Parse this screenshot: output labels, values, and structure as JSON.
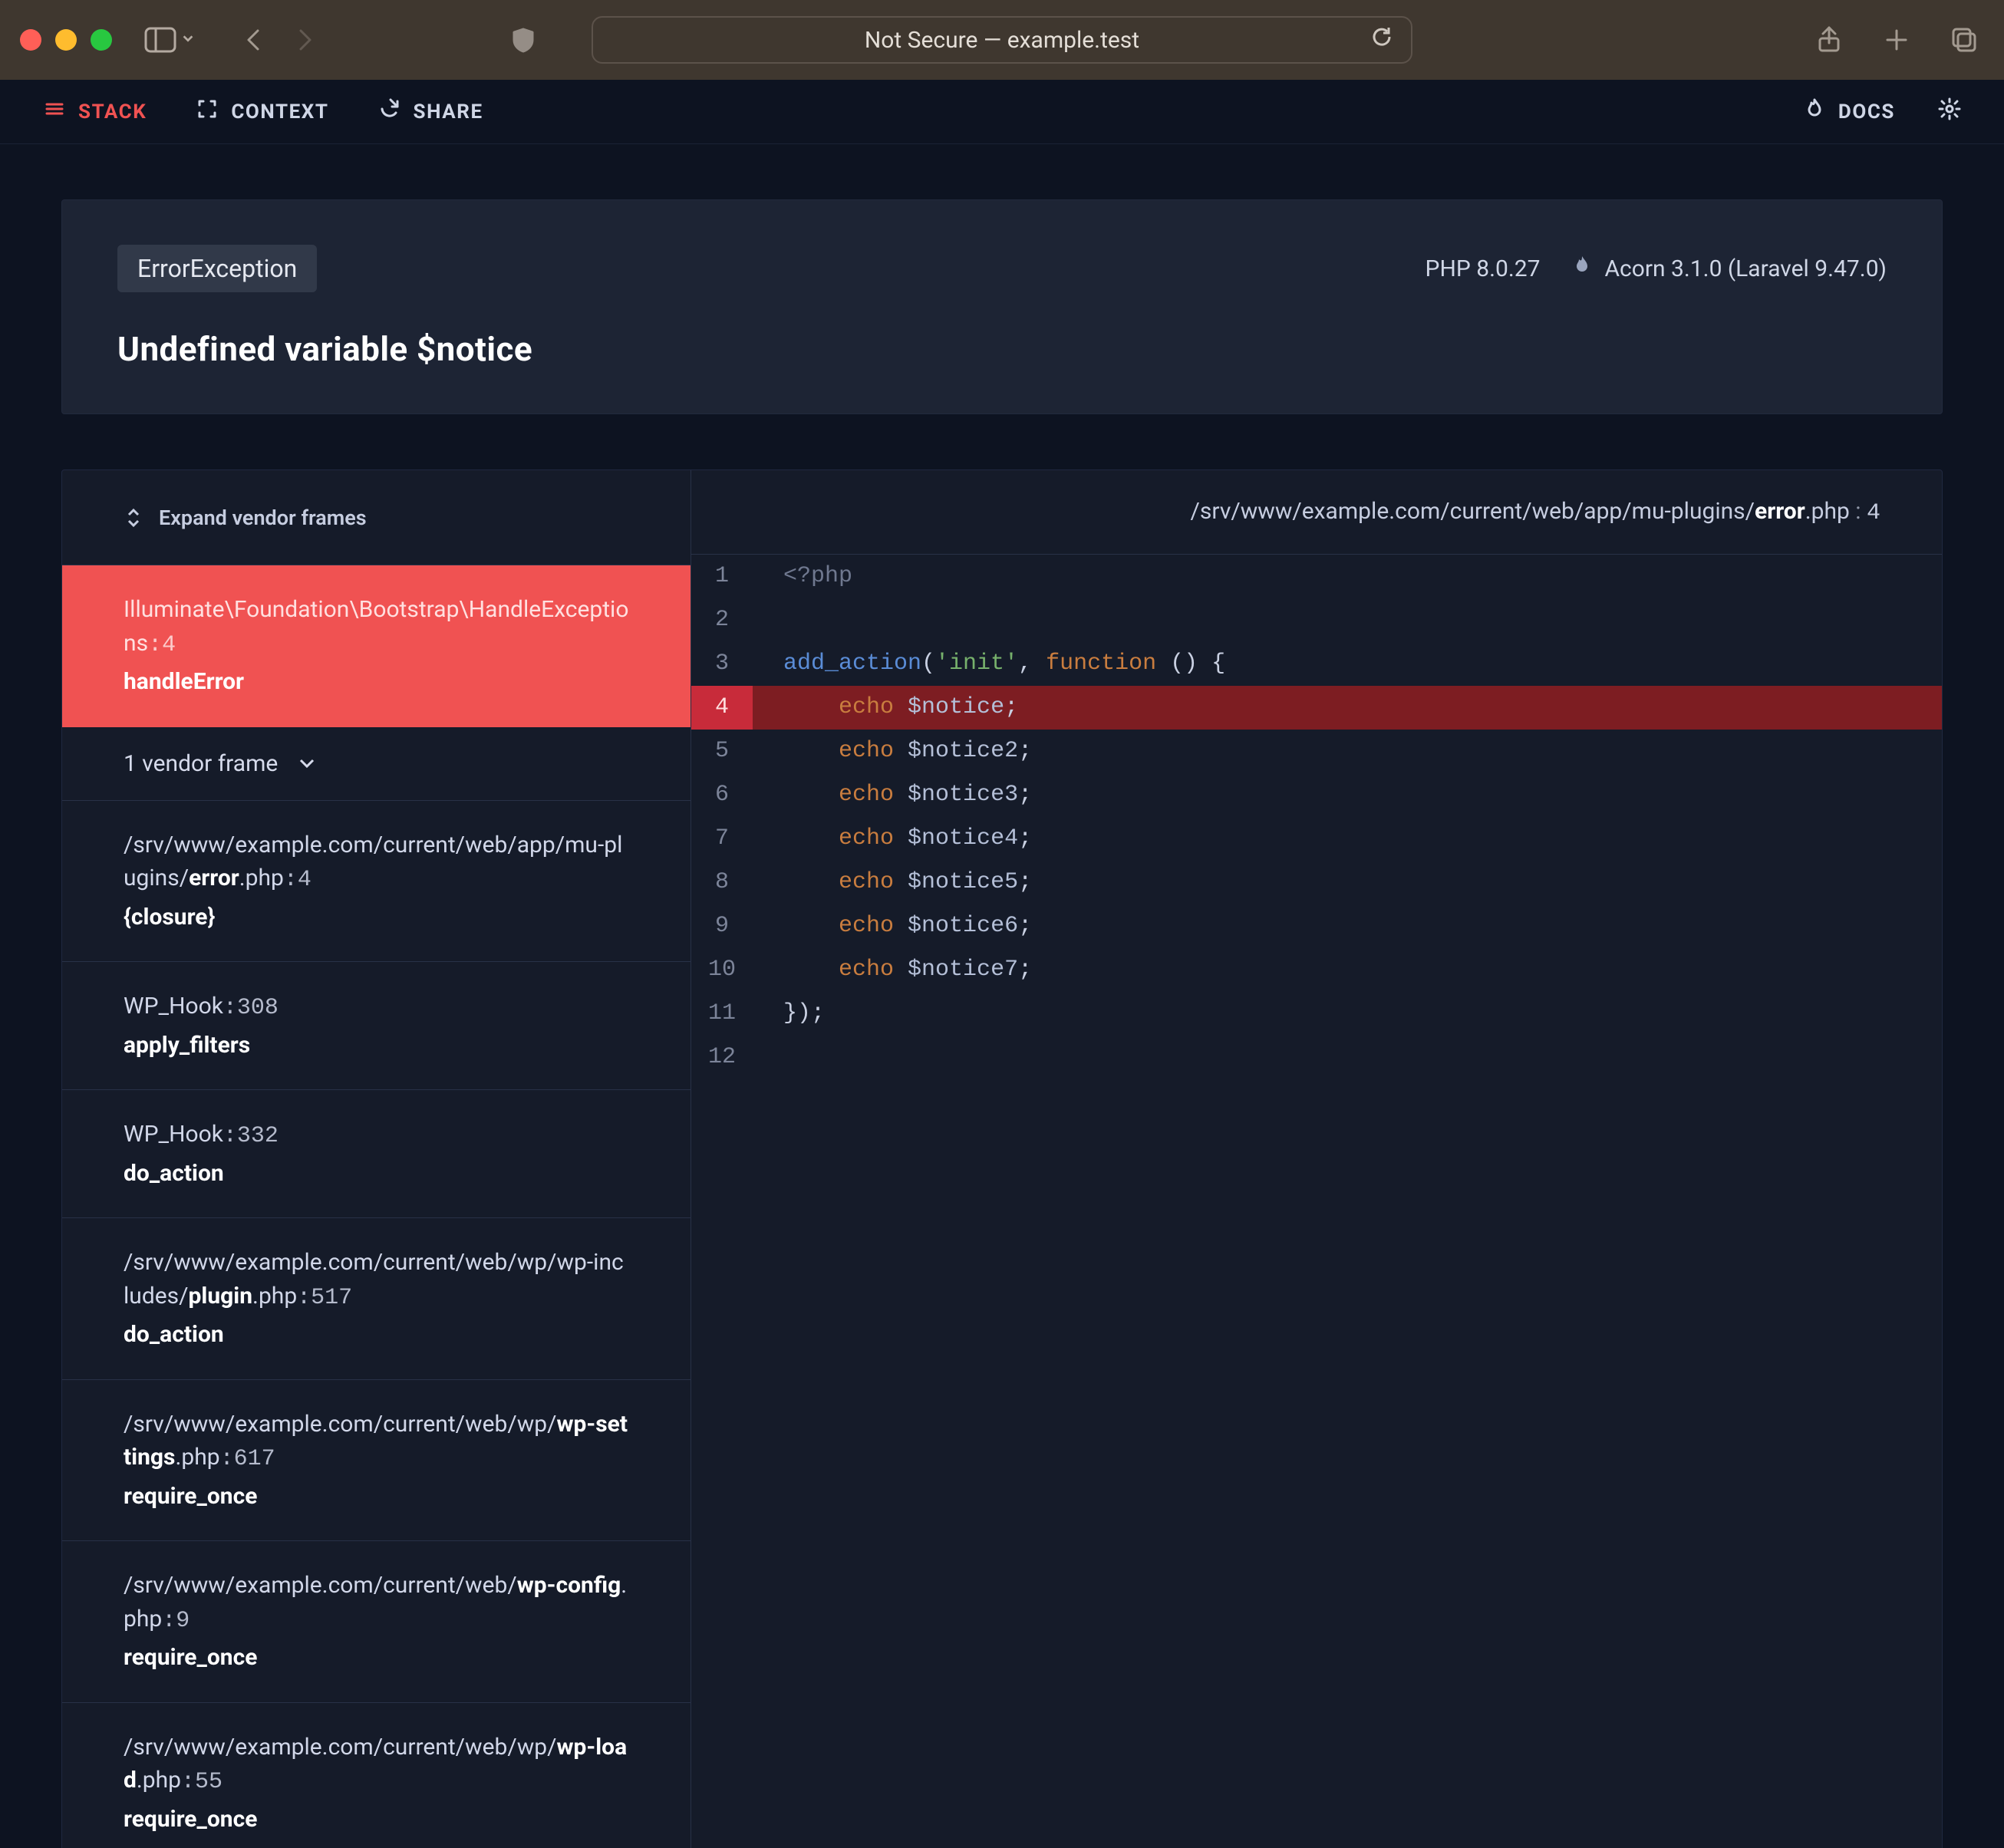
{
  "window": {
    "url_display": "Not Secure — example.test"
  },
  "menubar": {
    "items": [
      {
        "label": "STACK",
        "icon": "stack-icon",
        "active": true
      },
      {
        "label": "CONTEXT",
        "icon": "expand-icon",
        "active": false
      },
      {
        "label": "SHARE",
        "icon": "share-icon",
        "active": false
      }
    ],
    "docs_label": "DOCS"
  },
  "error": {
    "exception_class": "ErrorException",
    "message": "Undefined variable $notice",
    "php_version_label": "PHP 8.0.27",
    "framework_label": "Acorn 3.1.0 (Laravel 9.47.0)"
  },
  "frames": {
    "expand_label": "Expand vendor frames",
    "collapsed_label": "1 vendor frame",
    "list": [
      {
        "path": "Illuminate\\Foundation\\Bootstrap\\HandleExceptions",
        "line": "4",
        "fn": "handleError",
        "active": true,
        "path_style": "namespace"
      },
      {
        "collapsed": true
      },
      {
        "path": "/srv/www/example.com/current/web/app/mu-plugins/",
        "bold": "error",
        "ext": ".php",
        "line": "4",
        "fn": "{closure}"
      },
      {
        "path": "WP_Hook",
        "line": "308",
        "fn": "apply_filters",
        "path_style": "class"
      },
      {
        "path": "WP_Hook",
        "line": "332",
        "fn": "do_action",
        "path_style": "class"
      },
      {
        "path": "/srv/www/example.com/current/web/wp/wp-includes/",
        "bold": "plugin",
        "ext": ".php",
        "line": "517",
        "fn": "do_action"
      },
      {
        "path": "/srv/www/example.com/current/web/wp/",
        "bold": "wp-settings",
        "ext": ".php",
        "line": "617",
        "fn": "require_once"
      },
      {
        "path": "/srv/www/example.com/current/web/",
        "bold": "wp-config",
        "ext": ".php",
        "line": "9",
        "fn": "require_once"
      },
      {
        "path": "/srv/www/example.com/current/web/wp/",
        "bold": "wp-load",
        "ext": ".php",
        "line": "55",
        "fn": "require_once"
      }
    ]
  },
  "code": {
    "file_path_prefix": "/srv/www/example.com/current/web/app/mu-plugins/",
    "file_bold": "error",
    "file_ext": ".php",
    "file_line": "4",
    "highlight_line": 4,
    "lines": [
      {
        "n": 1,
        "tokens": [
          {
            "c": "pi",
            "t": "<?php"
          }
        ]
      },
      {
        "n": 2,
        "tokens": []
      },
      {
        "n": 3,
        "tokens": [
          {
            "c": "fn",
            "t": "add_action"
          },
          {
            "c": "p",
            "t": "("
          },
          {
            "c": "str",
            "t": "'init'"
          },
          {
            "c": "p",
            "t": ", "
          },
          {
            "c": "kw",
            "t": "function"
          },
          {
            "c": "p",
            "t": " () {"
          }
        ]
      },
      {
        "n": 4,
        "tokens": [
          {
            "c": "p",
            "t": "    "
          },
          {
            "c": "kw",
            "t": "echo"
          },
          {
            "c": "p",
            "t": " "
          },
          {
            "c": "var",
            "t": "$notice"
          },
          {
            "c": "p",
            "t": ";"
          }
        ]
      },
      {
        "n": 5,
        "tokens": [
          {
            "c": "p",
            "t": "    "
          },
          {
            "c": "kw",
            "t": "echo"
          },
          {
            "c": "p",
            "t": " "
          },
          {
            "c": "var",
            "t": "$notice2"
          },
          {
            "c": "p",
            "t": ";"
          }
        ]
      },
      {
        "n": 6,
        "tokens": [
          {
            "c": "p",
            "t": "    "
          },
          {
            "c": "kw",
            "t": "echo"
          },
          {
            "c": "p",
            "t": " "
          },
          {
            "c": "var",
            "t": "$notice3"
          },
          {
            "c": "p",
            "t": ";"
          }
        ]
      },
      {
        "n": 7,
        "tokens": [
          {
            "c": "p",
            "t": "    "
          },
          {
            "c": "kw",
            "t": "echo"
          },
          {
            "c": "p",
            "t": " "
          },
          {
            "c": "var",
            "t": "$notice4"
          },
          {
            "c": "p",
            "t": ";"
          }
        ]
      },
      {
        "n": 8,
        "tokens": [
          {
            "c": "p",
            "t": "    "
          },
          {
            "c": "kw",
            "t": "echo"
          },
          {
            "c": "p",
            "t": " "
          },
          {
            "c": "var",
            "t": "$notice5"
          },
          {
            "c": "p",
            "t": ";"
          }
        ]
      },
      {
        "n": 9,
        "tokens": [
          {
            "c": "p",
            "t": "    "
          },
          {
            "c": "kw",
            "t": "echo"
          },
          {
            "c": "p",
            "t": " "
          },
          {
            "c": "var",
            "t": "$notice6"
          },
          {
            "c": "p",
            "t": ";"
          }
        ]
      },
      {
        "n": 10,
        "tokens": [
          {
            "c": "p",
            "t": "    "
          },
          {
            "c": "kw",
            "t": "echo"
          },
          {
            "c": "p",
            "t": " "
          },
          {
            "c": "var",
            "t": "$notice7"
          },
          {
            "c": "p",
            "t": ";"
          }
        ]
      },
      {
        "n": 11,
        "tokens": [
          {
            "c": "p",
            "t": "});"
          }
        ]
      },
      {
        "n": 12,
        "tokens": []
      }
    ]
  }
}
